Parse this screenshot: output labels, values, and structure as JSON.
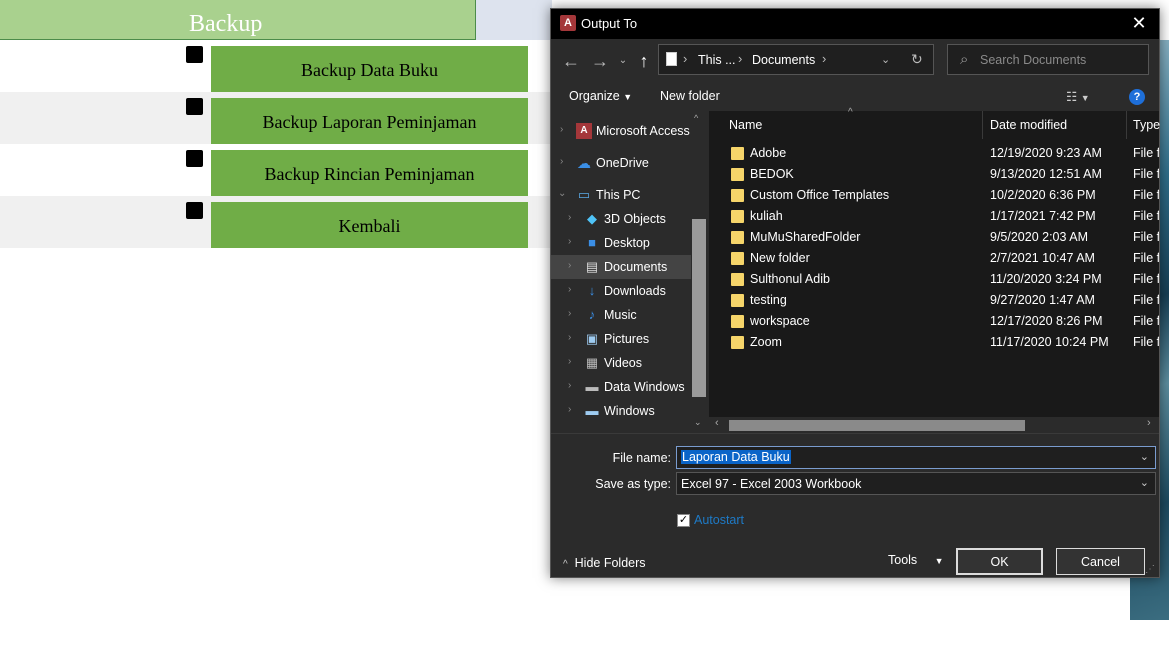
{
  "form": {
    "title": "Backup",
    "buttons": [
      {
        "label": "Backup Data Buku"
      },
      {
        "label": "Backup Laporan Peminjaman"
      },
      {
        "label": "Backup Rincian Peminjaman"
      },
      {
        "label": "Kembali"
      }
    ]
  },
  "dialog": {
    "title": "Output To",
    "close_glyph": "✕",
    "address": {
      "segments": [
        "This ...",
        "Documents"
      ]
    },
    "search": {
      "placeholder": "Search Documents"
    },
    "toolbar": {
      "organize": "Organize",
      "new_folder": "New folder",
      "help": "?"
    },
    "nav_pane": [
      {
        "label": "Microsoft Access",
        "icon": "access-icon"
      },
      {
        "label": "OneDrive",
        "icon": "cloud-icon"
      },
      {
        "label": "This PC",
        "icon": "pc-icon"
      },
      {
        "label": "3D Objects",
        "icon": "cube-icon"
      },
      {
        "label": "Desktop",
        "icon": "desktop-icon"
      },
      {
        "label": "Documents",
        "icon": "document-icon",
        "selected": true
      },
      {
        "label": "Downloads",
        "icon": "download-icon"
      },
      {
        "label": "Music",
        "icon": "music-icon"
      },
      {
        "label": "Pictures",
        "icon": "picture-icon"
      },
      {
        "label": "Videos",
        "icon": "video-icon"
      },
      {
        "label": "Data Windows",
        "icon": "drive-icon"
      },
      {
        "label": "Windows",
        "icon": "drive-icon"
      }
    ],
    "columns": {
      "name": "Name",
      "date": "Date modified",
      "type": "Type"
    },
    "files": [
      {
        "name": "Adobe",
        "date": "12/19/2020 9:23 AM",
        "type": "File fo"
      },
      {
        "name": "BEDOK",
        "date": "9/13/2020 12:51 AM",
        "type": "File fo"
      },
      {
        "name": "Custom Office Templates",
        "date": "10/2/2020 6:36 PM",
        "type": "File fo"
      },
      {
        "name": "kuliah",
        "date": "1/17/2021 7:42 PM",
        "type": "File fo"
      },
      {
        "name": "MuMuSharedFolder",
        "date": "9/5/2020 2:03 AM",
        "type": "File fo"
      },
      {
        "name": "New folder",
        "date": "2/7/2021 10:47 AM",
        "type": "File fo"
      },
      {
        "name": "Sulthonul Adib",
        "date": "11/20/2020 3:24 PM",
        "type": "File fo"
      },
      {
        "name": "testing",
        "date": "9/27/2020 1:47 AM",
        "type": "File fo"
      },
      {
        "name": "workspace",
        "date": "12/17/2020 8:26 PM",
        "type": "File fo"
      },
      {
        "name": "Zoom",
        "date": "11/17/2020 10:24 PM",
        "type": "File fo"
      }
    ],
    "file_name_label": "File name:",
    "file_name_value": "Laporan Data Buku",
    "save_type_label": "Save as type:",
    "save_type_value": "Excel 97 - Excel 2003 Workbook",
    "autostart_label": "Autostart",
    "autostart_checked": true,
    "hide_folders": "Hide Folders",
    "tools": "Tools",
    "ok": "OK",
    "cancel": "Cancel"
  }
}
